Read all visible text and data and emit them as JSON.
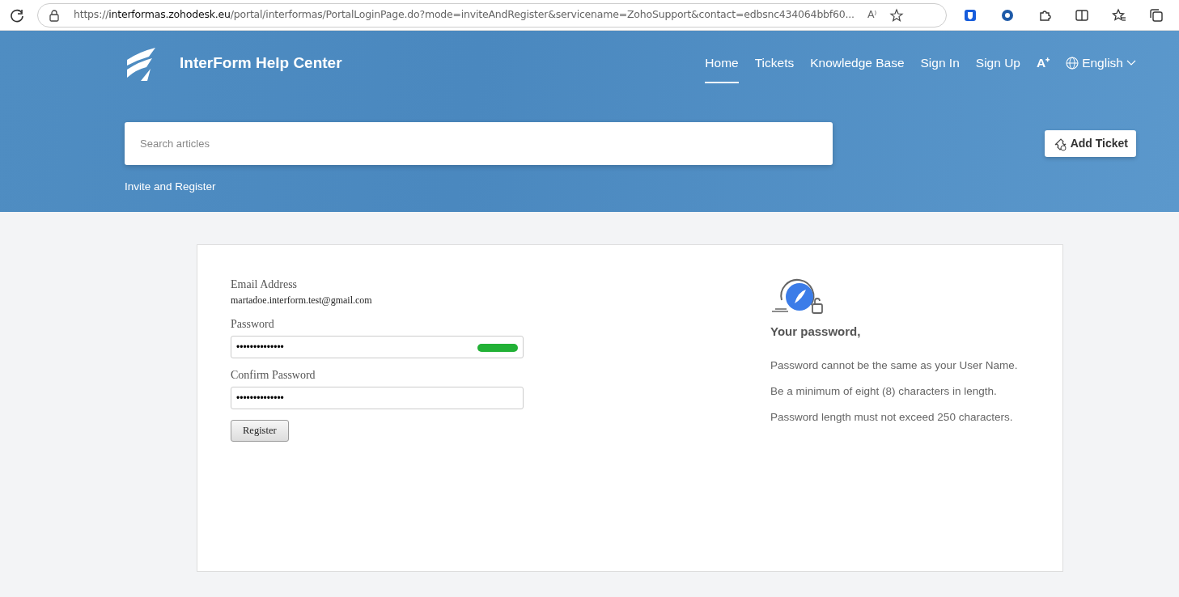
{
  "browser": {
    "url": "https://**interformas.zohodesk.eu**/portal/interformas/PortalLoginPage.do?mode=inviteAndRegister&servicename=ZohoSupport&contact=edbsnc434064bbf60...",
    "read_aloud": "A⁾"
  },
  "header": {
    "title": "InterForm Help Center",
    "nav": [
      {
        "label": "Home",
        "selected": true
      },
      {
        "label": "Tickets",
        "selected": false
      },
      {
        "label": "Knowledge Base",
        "selected": false
      },
      {
        "label": "Sign In",
        "selected": false
      },
      {
        "label": "Sign Up",
        "selected": false
      }
    ],
    "font_size": "A⁺",
    "language": "English",
    "search": {
      "placeholder": "Search articles"
    },
    "add_ticket": "Add Ticket",
    "breadcrumb": "Invite and Register"
  },
  "form": {
    "email_label": "Email Address",
    "email": "martadoe.interform.test@gmail.com",
    "password_label": "Password",
    "password": "••••••••••••••",
    "strength": {
      "level": 1
    },
    "confirm_label": "Confirm Password",
    "confirm": "••••••••••••••",
    "submit": "Register"
  },
  "rules": {
    "title": "Your password,",
    "items": [
      "Password cannot be the same as your User Name.",
      "Be a minimum of eight (8) characters in length.",
      "Password length must not exceed 250 characters."
    ]
  }
}
